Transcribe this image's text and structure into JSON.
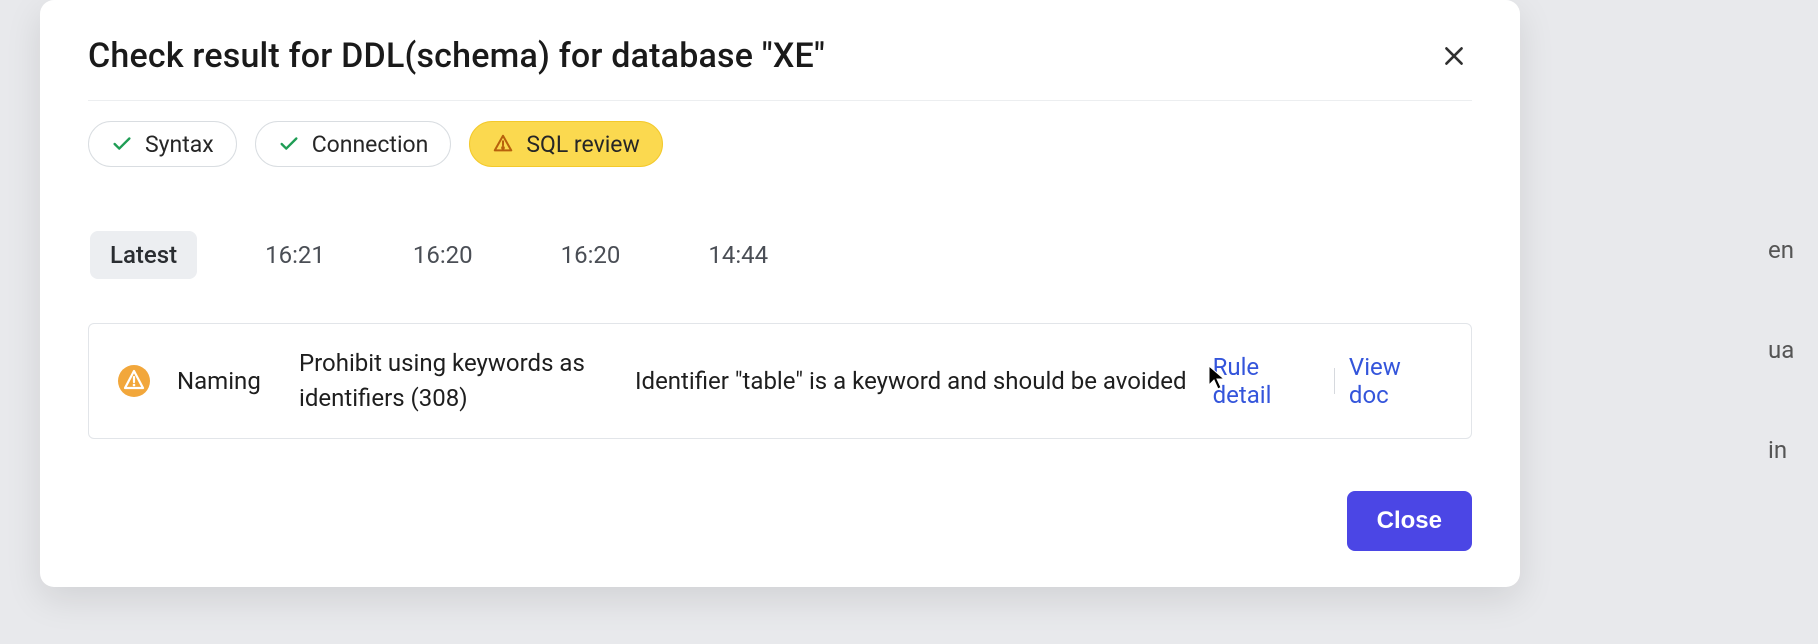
{
  "modal": {
    "title": "Check result for DDL(schema) for database \"XE\"",
    "close_button_label": "Close"
  },
  "status_pills": [
    {
      "label": "Syntax",
      "status": "ok"
    },
    {
      "label": "Connection",
      "status": "ok"
    },
    {
      "label": "SQL review",
      "status": "warn"
    }
  ],
  "time_tabs": {
    "active": "Latest",
    "items": [
      "Latest",
      "16:21",
      "16:20",
      "16:20",
      "14:44"
    ]
  },
  "result": {
    "severity": "warning",
    "category": "Naming",
    "rule": "Prohibit using keywords as identifiers (308)",
    "message": "Identifier \"table\" is a keyword and should be avoided",
    "rule_detail_label": "Rule detail",
    "view_doc_label": "View doc"
  },
  "bg_peek": [
    "en",
    "ua",
    "in"
  ]
}
